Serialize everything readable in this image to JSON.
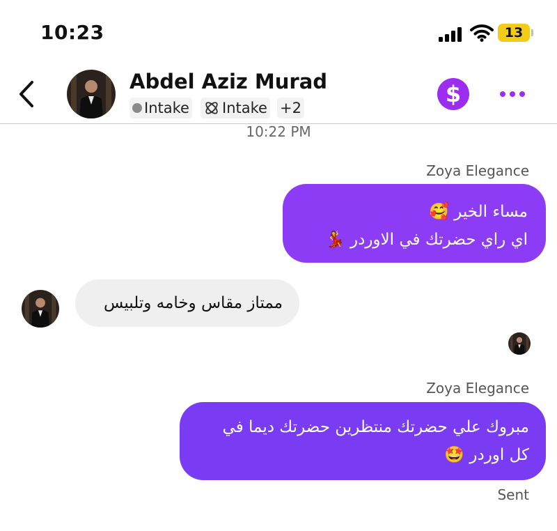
{
  "status_bar": {
    "time": "10:23",
    "battery": "13"
  },
  "header": {
    "name": "Abdel Aziz Murad",
    "tags": [
      "Intake",
      "Intake",
      "+2"
    ],
    "icons": [
      "back-chevron-icon",
      "dollar-icon",
      "more-dots-icon"
    ]
  },
  "conversation": {
    "timestamp": "10:22 PM",
    "messages": [
      {
        "direction": "out",
        "sender": "Zoya Elegance",
        "lines": [
          "مساء الخير 🥰",
          "اي راي حضرتك في الاوردر 💃"
        ]
      },
      {
        "direction": "in",
        "lines": [
          "ممتاز مقاس وخامه وتلبيس"
        ]
      },
      {
        "direction": "out",
        "sender": "Zoya Elegance",
        "lines": [
          "مبروك علي حضرتك منتظرين حضرتك ديما في",
          "كل اوردر 🤩"
        ]
      }
    ],
    "status": "Sent"
  },
  "colors": {
    "accent": "#9b2cf0",
    "bubble_out_1": "#8c3cf5",
    "bubble_out_2": "#7a3cf2",
    "bubble_in": "#efefef",
    "battery": "#f2cc18"
  }
}
